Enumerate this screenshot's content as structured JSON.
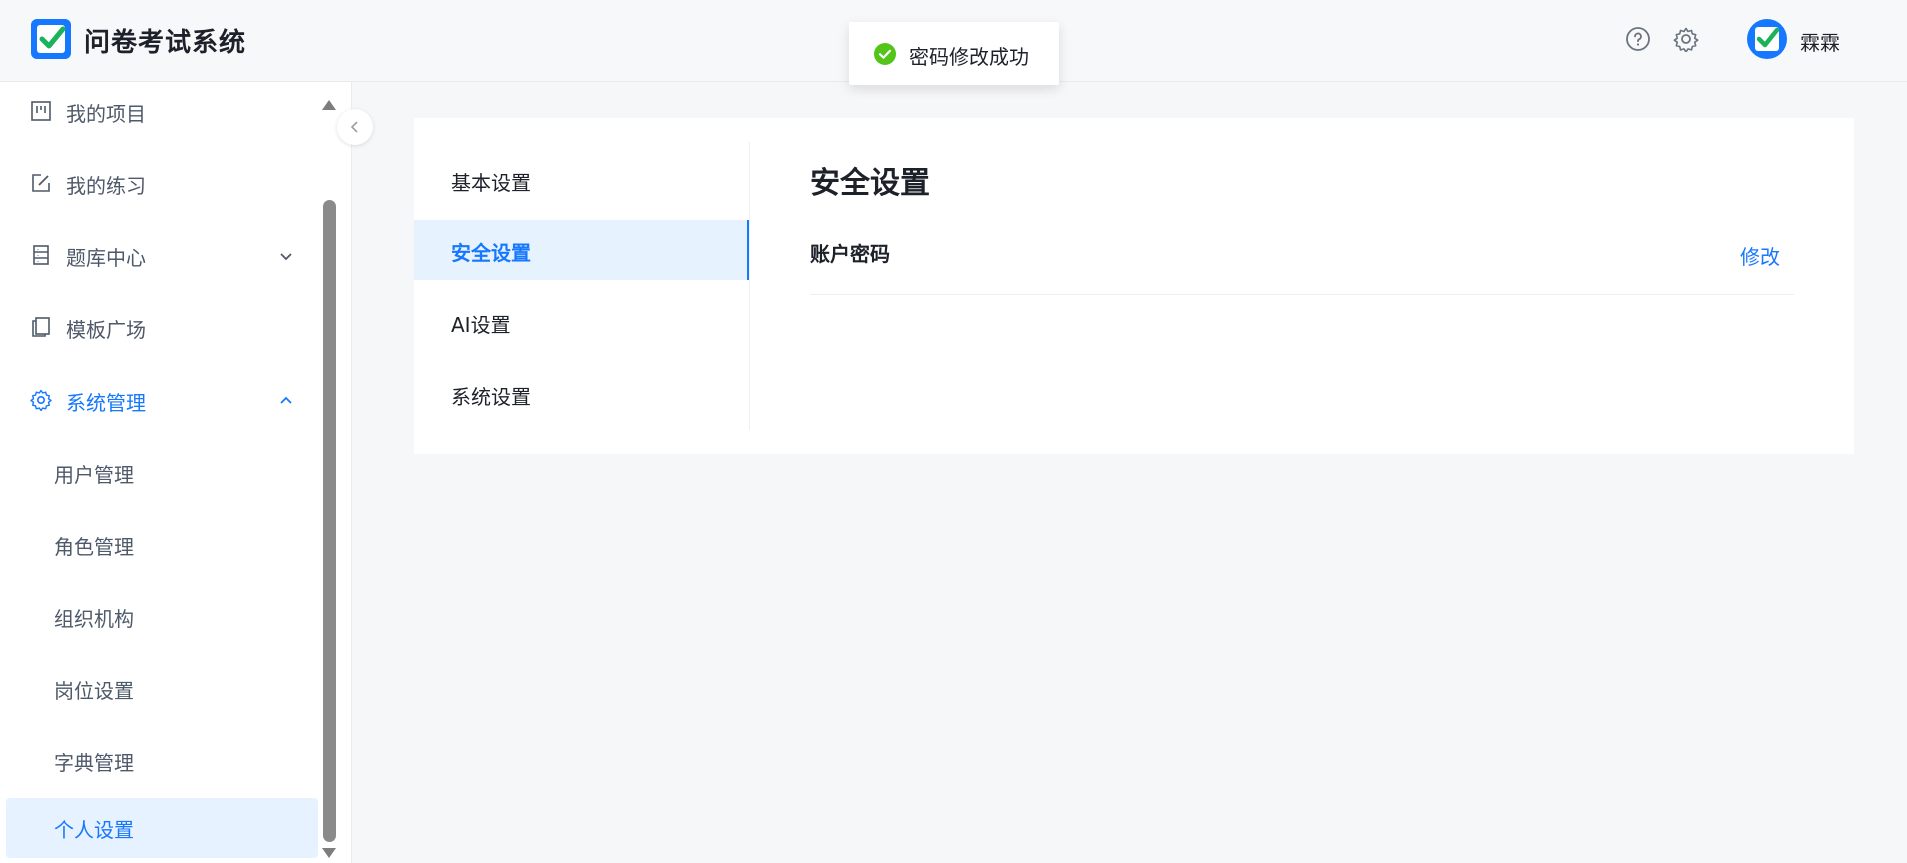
{
  "header": {
    "app_title": "问卷考试系统",
    "icons": [
      "help-icon",
      "settings-icon"
    ],
    "user_name": "霖霖"
  },
  "toast": {
    "message": "密码修改成功",
    "status_color": "#52c41a"
  },
  "sidebar": {
    "items": [
      {
        "label": "我的项目",
        "icon": "project-icon"
      },
      {
        "label": "我的练习",
        "icon": "edit-icon"
      },
      {
        "label": "题库中心",
        "icon": "database-icon",
        "expandable": true
      },
      {
        "label": "模板广场",
        "icon": "template-icon"
      },
      {
        "label": "系统管理",
        "icon": "gear-icon",
        "expanded": true
      }
    ],
    "sub_items": [
      {
        "label": "用户管理"
      },
      {
        "label": "角色管理"
      },
      {
        "label": "组织机构"
      },
      {
        "label": "岗位设置"
      },
      {
        "label": "字典管理"
      },
      {
        "label": "个人设置",
        "selected": true
      }
    ]
  },
  "settings_menu": {
    "items": [
      {
        "label": "基本设置"
      },
      {
        "label": "安全设置",
        "active": true
      },
      {
        "label": "AI设置"
      },
      {
        "label": "系统设置"
      }
    ]
  },
  "panel": {
    "title": "安全设置",
    "row_label": "账户密码",
    "row_action": "修改"
  },
  "colors": {
    "accent": "#1677ff",
    "selected_bg": "#e6f3ff",
    "success": "#52c41a"
  }
}
